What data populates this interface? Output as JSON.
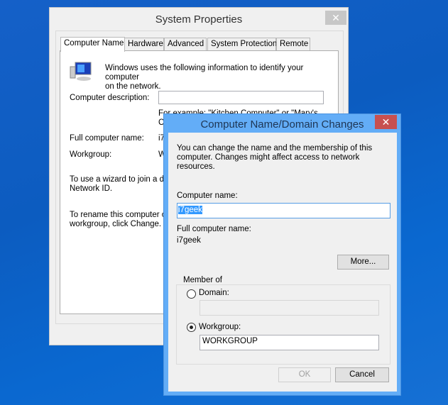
{
  "system_properties": {
    "title": "System Properties",
    "close_glyph": "✕",
    "tabs": [
      {
        "label": "Computer Name",
        "active": true
      },
      {
        "label": "Hardware"
      },
      {
        "label": "Advanced"
      },
      {
        "label": "System Protection"
      },
      {
        "label": "Remote"
      }
    ],
    "intro_line1": "Windows uses the following information to identify your computer",
    "intro_line2": "on the network.",
    "icon": "computer-icon",
    "description_label": "Computer description:",
    "description_value": "",
    "example_line1": "For example: \"Kitchen Computer\" or \"Mary's",
    "example_line2": "C",
    "full_name_label": "Full computer name:",
    "full_name_value": "i7",
    "workgroup_label": "Workgroup:",
    "workgroup_value": "W",
    "wizard_line1": "To use a wizard to join a do",
    "wizard_line2": "Network ID.",
    "rename_line1": "To rename this computer or",
    "rename_line2": "workgroup, click Change."
  },
  "dialog": {
    "title": "Computer Name/Domain Changes",
    "close_glyph": "✕",
    "intro_line1": "You can change the name and the membership of this",
    "intro_line2": "computer. Changes might affect access to network resources.",
    "computer_name_label": "Computer name:",
    "computer_name_value": "i7geek",
    "full_name_label": "Full computer name:",
    "full_name_value": "i7geek",
    "more_label": "More...",
    "member_of_label": "Member of",
    "domain_label": "Domain:",
    "domain_value": "",
    "domain_selected": false,
    "workgroup_label": "Workgroup:",
    "workgroup_value": "WORKGROUP",
    "workgroup_selected": true,
    "ok_label": "OK",
    "cancel_label": "Cancel"
  },
  "colors": {
    "desktop": "#0c5cc0",
    "dialog_frame": "#63adf7",
    "close_red": "#c75050",
    "selection": "#3399ff"
  }
}
